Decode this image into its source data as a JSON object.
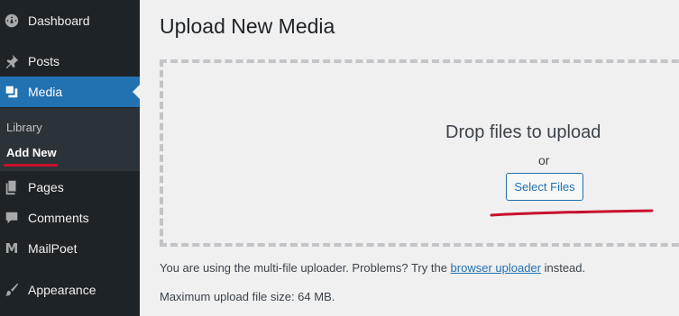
{
  "sidebar": {
    "items": [
      {
        "label": "Dashboard",
        "icon": "dashboard-icon"
      },
      {
        "label": "Posts",
        "icon": "pushpin-icon"
      },
      {
        "label": "Media",
        "icon": "media-icon"
      },
      {
        "label": "Pages",
        "icon": "pages-icon"
      },
      {
        "label": "Comments",
        "icon": "comment-icon"
      },
      {
        "label": "MailPoet",
        "icon": "mailpoet-icon",
        "glyph": "M"
      },
      {
        "label": "Appearance",
        "icon": "paintbrush-icon"
      }
    ],
    "submenu": [
      {
        "label": "Library"
      },
      {
        "label": "Add New"
      }
    ]
  },
  "main": {
    "title": "Upload New Media",
    "drop_text": "Drop files to upload",
    "or_text": "or",
    "select_button": "Select Files",
    "info_prefix": "You are using the multi-file uploader. Problems? Try the ",
    "info_link": "browser uploader",
    "info_suffix": " instead.",
    "max_size": "Maximum upload file size: 64 MB."
  },
  "colors": {
    "sidebar_bg": "#1d2327",
    "submenu_bg": "#2c3338",
    "accent": "#2271b1",
    "annotation_red": "#c8102e",
    "page_bg": "#f0f0f1"
  }
}
